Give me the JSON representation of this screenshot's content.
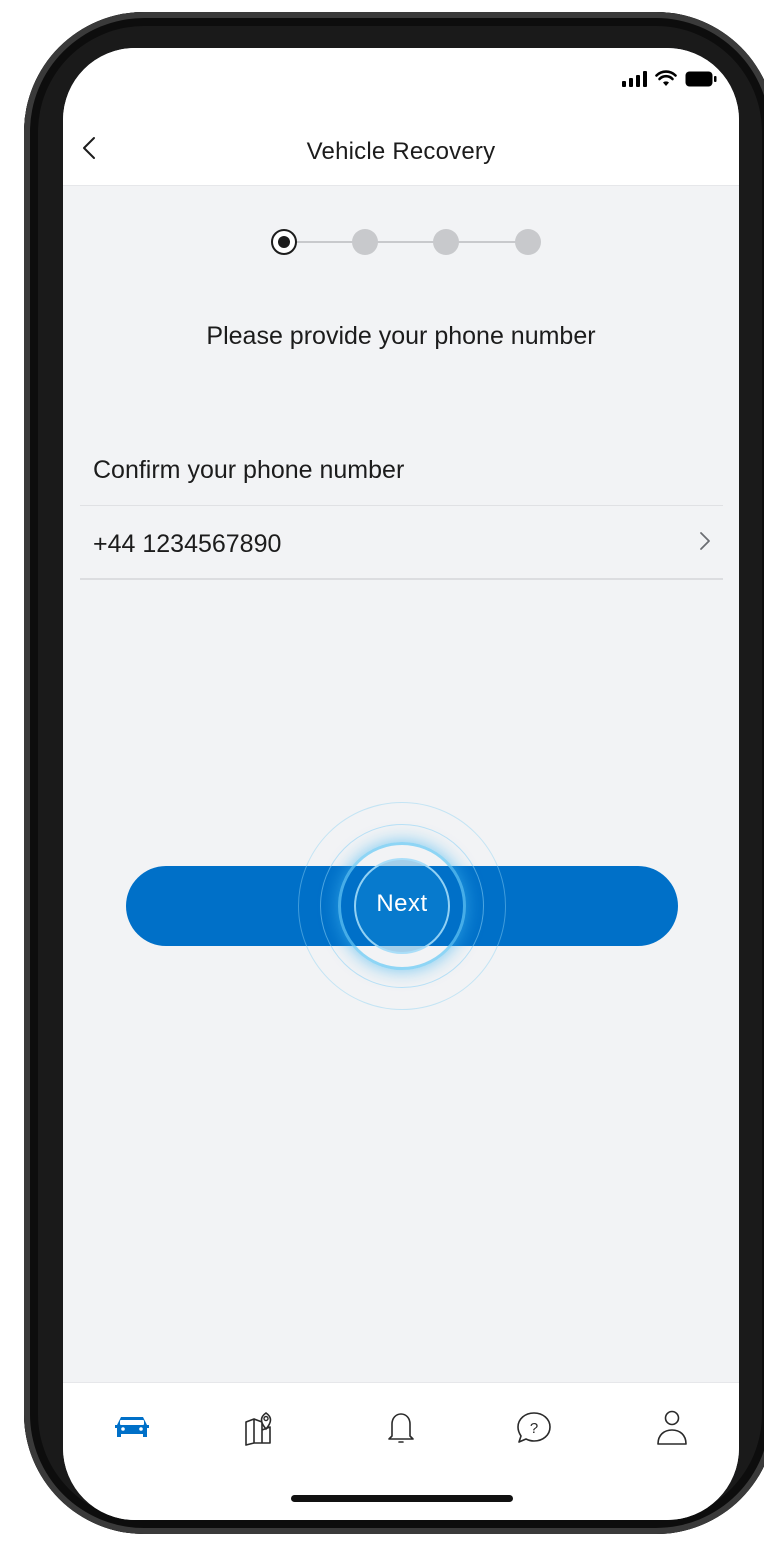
{
  "header": {
    "title": "Vehicle Recovery",
    "back_icon": "chevron-left-icon"
  },
  "status_bar": {
    "icons": [
      "signal-icon",
      "wifi-icon",
      "battery-icon"
    ]
  },
  "stepper": {
    "total_steps": 4,
    "current_step": 1
  },
  "main": {
    "instruction": "Please provide your phone number",
    "section_label": "Confirm your phone number",
    "phone_number": "+44 1234567890",
    "next_label": "Next"
  },
  "tab_bar": {
    "items": [
      {
        "icon": "car-icon",
        "active": true
      },
      {
        "icon": "map-pin-icon",
        "active": false
      },
      {
        "icon": "bell-icon",
        "active": false
      },
      {
        "icon": "help-chat-icon",
        "active": false
      },
      {
        "icon": "person-icon",
        "active": false
      }
    ]
  },
  "colors": {
    "accent": "#0070c8",
    "background": "#f2f3f5",
    "text": "#1c1c1c",
    "inactive": "#c8c9cc"
  }
}
